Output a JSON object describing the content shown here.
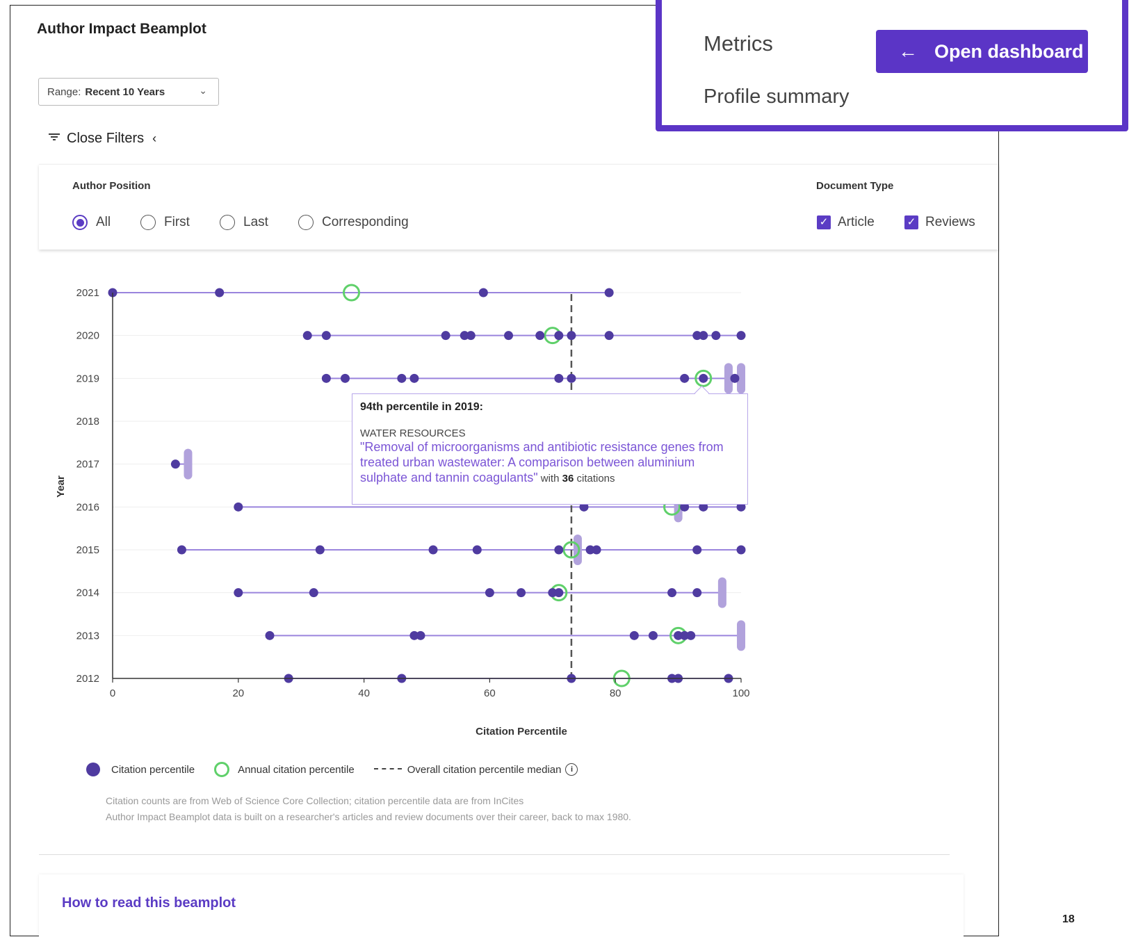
{
  "title": "Author Impact Beamplot",
  "range": {
    "label": "Range:",
    "value": "Recent 10 Years"
  },
  "filters_toggle": "Close Filters",
  "author_position": {
    "label": "Author Position",
    "options": [
      "All",
      "First",
      "Last",
      "Corresponding"
    ],
    "selected": "All"
  },
  "document_type": {
    "label": "Document Type",
    "options": [
      {
        "label": "Article",
        "checked": true
      },
      {
        "label": "Reviews",
        "checked": true
      }
    ]
  },
  "chart_data": {
    "type": "scatter",
    "xlabel": "Citation Percentile",
    "ylabel": "Year",
    "xlim": [
      0,
      100
    ],
    "xticks": [
      0,
      20,
      40,
      60,
      80,
      100
    ],
    "years": [
      2021,
      2020,
      2019,
      2018,
      2017,
      2016,
      2015,
      2014,
      2013,
      2012
    ],
    "median": 73,
    "series": [
      {
        "name": "Citation percentile",
        "points": [
          {
            "year": 2021,
            "x": [
              0,
              17,
              59,
              79
            ]
          },
          {
            "year": 2020,
            "x": [
              31,
              34,
              53,
              56,
              57,
              63,
              68,
              71,
              73,
              79,
              93,
              94,
              96,
              100
            ]
          },
          {
            "year": 2019,
            "x": [
              34,
              37,
              46,
              48,
              71,
              73,
              91,
              94,
              99
            ]
          },
          {
            "year": 2018,
            "x": []
          },
          {
            "year": 2017,
            "x": [
              10
            ]
          },
          {
            "year": 2016,
            "x": [
              20,
              75,
              91,
              94,
              100
            ]
          },
          {
            "year": 2015,
            "x": [
              11,
              33,
              51,
              58,
              71,
              76,
              77,
              93,
              100
            ]
          },
          {
            "year": 2014,
            "x": [
              20,
              32,
              60,
              65,
              70,
              71,
              89,
              93
            ]
          },
          {
            "year": 2013,
            "x": [
              25,
              48,
              49,
              83,
              86,
              90,
              91,
              92
            ]
          },
          {
            "year": 2012,
            "x": [
              28,
              46,
              73,
              89,
              90,
              98
            ]
          }
        ]
      },
      {
        "name": "Annual citation percentile",
        "points": [
          {
            "year": 2021,
            "x": 38
          },
          {
            "year": 2020,
            "x": 70
          },
          {
            "year": 2019,
            "x": 94
          },
          {
            "year": 2016,
            "x": 89
          },
          {
            "year": 2015,
            "x": 73
          },
          {
            "year": 2014,
            "x": 71
          },
          {
            "year": 2013,
            "x": 90
          },
          {
            "year": 2012,
            "x": 81
          }
        ]
      }
    ],
    "uncited_bars": [
      {
        "year": 2019,
        "x": [
          98,
          100
        ]
      },
      {
        "year": 2017,
        "x": [
          12
        ]
      },
      {
        "year": 2016,
        "x": [
          90
        ]
      },
      {
        "year": 2015,
        "x": [
          74
        ]
      },
      {
        "year": 2014,
        "x": [
          97
        ]
      },
      {
        "year": 2013,
        "x": [
          100
        ]
      }
    ],
    "colors": {
      "point": "#4f3ba0",
      "annual": "#5fd06a",
      "beam": "#9a84dd",
      "median": "#555555",
      "uncited": "#b1a2dc"
    }
  },
  "tooltip": {
    "header": "94th percentile in 2019:",
    "category": "WATER RESOURCES",
    "paper_title": "\"Removal of microorganisms and antibiotic resistance genes from treated urban wastewater: A comparison between aluminium sulphate and tannin coagulants\"",
    "with": "with",
    "citations": "36",
    "citations_word": "citations"
  },
  "legend": {
    "citation": "Citation percentile",
    "annual": "Annual citation percentile",
    "median": "Overall citation percentile median",
    "info": "i"
  },
  "footnotes": {
    "line1": "Citation counts are from Web of Science Core Collection; citation percentile data are from InCites",
    "line2": "Author Impact Beamplot data is built on a researcher's articles and review documents over their career, back to max 1980."
  },
  "how_to_read": "How to read this beamplot",
  "popup": {
    "metrics": "Metrics",
    "profile": "Profile summary",
    "button": "Open dashboard"
  },
  "page_number": "18"
}
